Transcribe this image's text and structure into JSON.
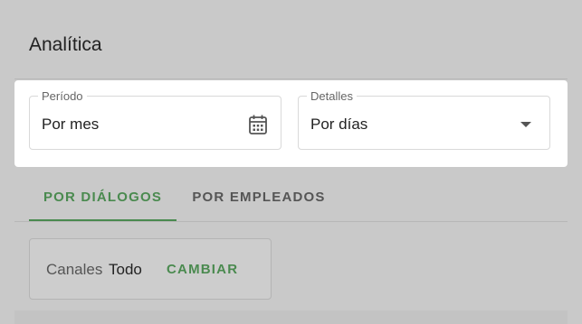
{
  "header": {
    "title": "Analítica"
  },
  "filters": {
    "period": {
      "label": "Período",
      "value": "Por mes",
      "icon": "calendar-icon"
    },
    "details": {
      "label": "Detalles",
      "value": "Por días",
      "icon": "dropdown-arrow-icon"
    }
  },
  "tabs": [
    {
      "label": "POR DIÁLOGOS",
      "active": true
    },
    {
      "label": "POR EMPLEADOS",
      "active": false
    }
  ],
  "channels": {
    "label": "Canales",
    "value": "Todo",
    "button": "CAMBIAR"
  },
  "colors": {
    "accent": "#4a8a4f",
    "background": "#c9c9c9",
    "card": "#ffffff"
  }
}
